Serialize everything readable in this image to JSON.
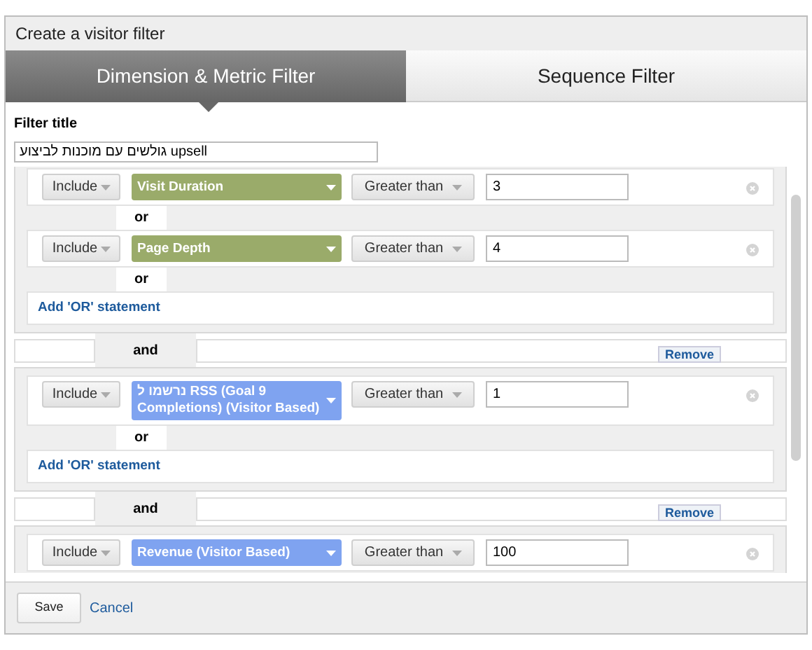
{
  "window": {
    "title": "Create a visitor filter"
  },
  "tabs": [
    {
      "label": "Dimension & Metric Filter",
      "selected": true
    },
    {
      "label": "Sequence Filter",
      "selected": false
    }
  ],
  "filter_title": {
    "label": "Filter title",
    "value": "גולשים עם מוכנות לביצוע upsell"
  },
  "groups": [
    {
      "conditions": [
        {
          "include": "Include",
          "metric": "Visit Duration",
          "color": "#9aab6a",
          "operator": "Greater than",
          "value": "3",
          "or_label": "or"
        },
        {
          "include": "Include",
          "metric": "Page Depth",
          "color": "#9aab6a",
          "operator": "Greater than",
          "value": "4",
          "or_label": "or"
        }
      ],
      "add_or": "Add 'OR' statement",
      "and_label": "and",
      "remove": "Remove"
    },
    {
      "conditions": [
        {
          "include": "Include",
          "metric": "נרשמו ל RSS (Goal 9 Completions) (Visitor Based)",
          "color": "#7fa3f0",
          "operator": "Greater than",
          "value": "1",
          "or_label": "or"
        }
      ],
      "add_or": "Add 'OR' statement",
      "and_label": "and",
      "remove": "Remove"
    },
    {
      "conditions": [
        {
          "include": "Include",
          "metric": "Revenue (Visitor Based)",
          "color": "#7fa3f0",
          "operator": "Greater than",
          "value": "100"
        }
      ]
    }
  ],
  "footer": {
    "save": "Save",
    "cancel": "Cancel"
  }
}
